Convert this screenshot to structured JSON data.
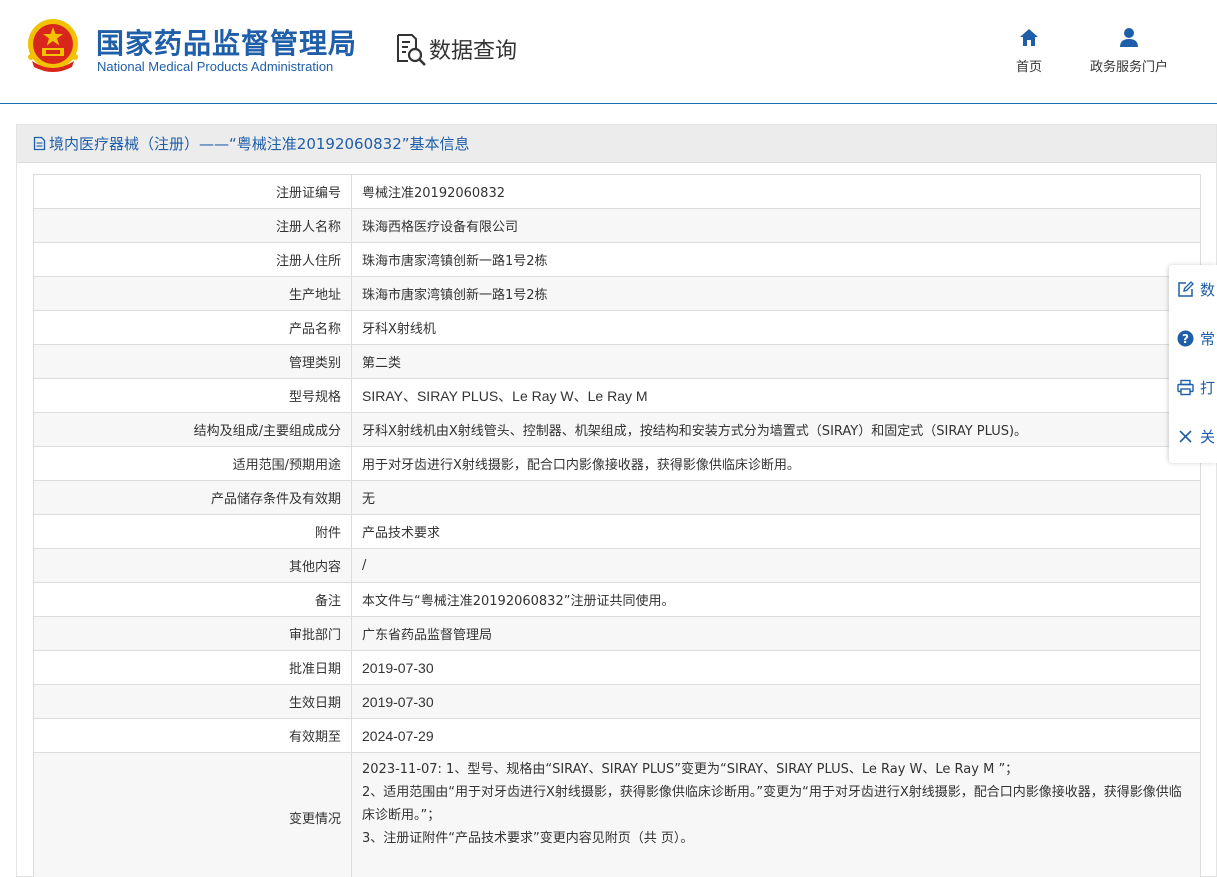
{
  "header": {
    "org_name_cn": "国家药品监督管理局",
    "org_name_en": "National Medical Products Administration",
    "data_query_label": "数据查询",
    "nav": {
      "home_label": "首页",
      "portal_label": "政务服务门户"
    }
  },
  "panel": {
    "title": "境内医疗器械（注册）——“粤械注准20192060832”基本信息"
  },
  "record": {
    "rows": [
      {
        "label": "注册证编号",
        "value": "粤械注准20192060832"
      },
      {
        "label": "注册人名称",
        "value": "珠海西格医疗设备有限公司"
      },
      {
        "label": "注册人住所",
        "value": "珠海市唐家湾镇创新一路1号2栋"
      },
      {
        "label": "生产地址",
        "value": "珠海市唐家湾镇创新一路1号2栋"
      },
      {
        "label": "产品名称",
        "value": "牙科X射线机"
      },
      {
        "label": "管理类别",
        "value": "第二类"
      },
      {
        "label": "型号规格",
        "value": "SIRAY、SIRAY PLUS、Le Ray W、Le Ray M"
      },
      {
        "label": "结构及组成/主要组成成分",
        "value": "牙科X射线机由X射线管头、控制器、机架组成，按结构和安装方式分为墙置式（SIRAY）和固定式（SIRAY PLUS)。"
      },
      {
        "label": "适用范围/预期用途",
        "value": "用于对牙齿进行X射线摄影，配合口内影像接收器，获得影像供临床诊断用。"
      },
      {
        "label": "产品储存条件及有效期",
        "value": "无"
      },
      {
        "label": "附件",
        "value": "产品技术要求"
      },
      {
        "label": "其他内容",
        "value": "/"
      },
      {
        "label": "备注",
        "value": "本文件与“粤械注准20192060832”注册证共同使用。"
      },
      {
        "label": "审批部门",
        "value": "广东省药品监督管理局"
      },
      {
        "label": "批准日期",
        "value": "2019-07-30"
      },
      {
        "label": "生效日期",
        "value": "2019-07-30"
      },
      {
        "label": "有效期至",
        "value": "2024-07-29"
      }
    ],
    "changes": {
      "label": "变更情况",
      "lines": [
        "2023-11-07: 1、型号、规格由“SIRAY、SIRAY PLUS”变更为“SIRAY、SIRAY PLUS、Le Ray W、Le Ray M ”；",
        "2、适用范围由“用于对牙齿进行X射线摄影，获得影像供临床诊断用。”变更为“用于对牙齿进行X射线摄影，配合口内影像接收器，获得影像供临床诊断用。”；",
        "3、注册证附件“产品技术要求”变更内容见附页（共 页）。"
      ]
    }
  },
  "sidebar": {
    "items": [
      {
        "label": "数",
        "icon": "edit-icon"
      },
      {
        "label": "常",
        "icon": "help-icon"
      },
      {
        "label": "打",
        "icon": "print-icon"
      },
      {
        "label": "关",
        "icon": "close-icon"
      }
    ]
  },
  "colors": {
    "brand_blue": "#1f5ea8",
    "header_rule": "#1a6fb5",
    "emblem_red": "#d9261c",
    "emblem_gold": "#f2c200"
  }
}
